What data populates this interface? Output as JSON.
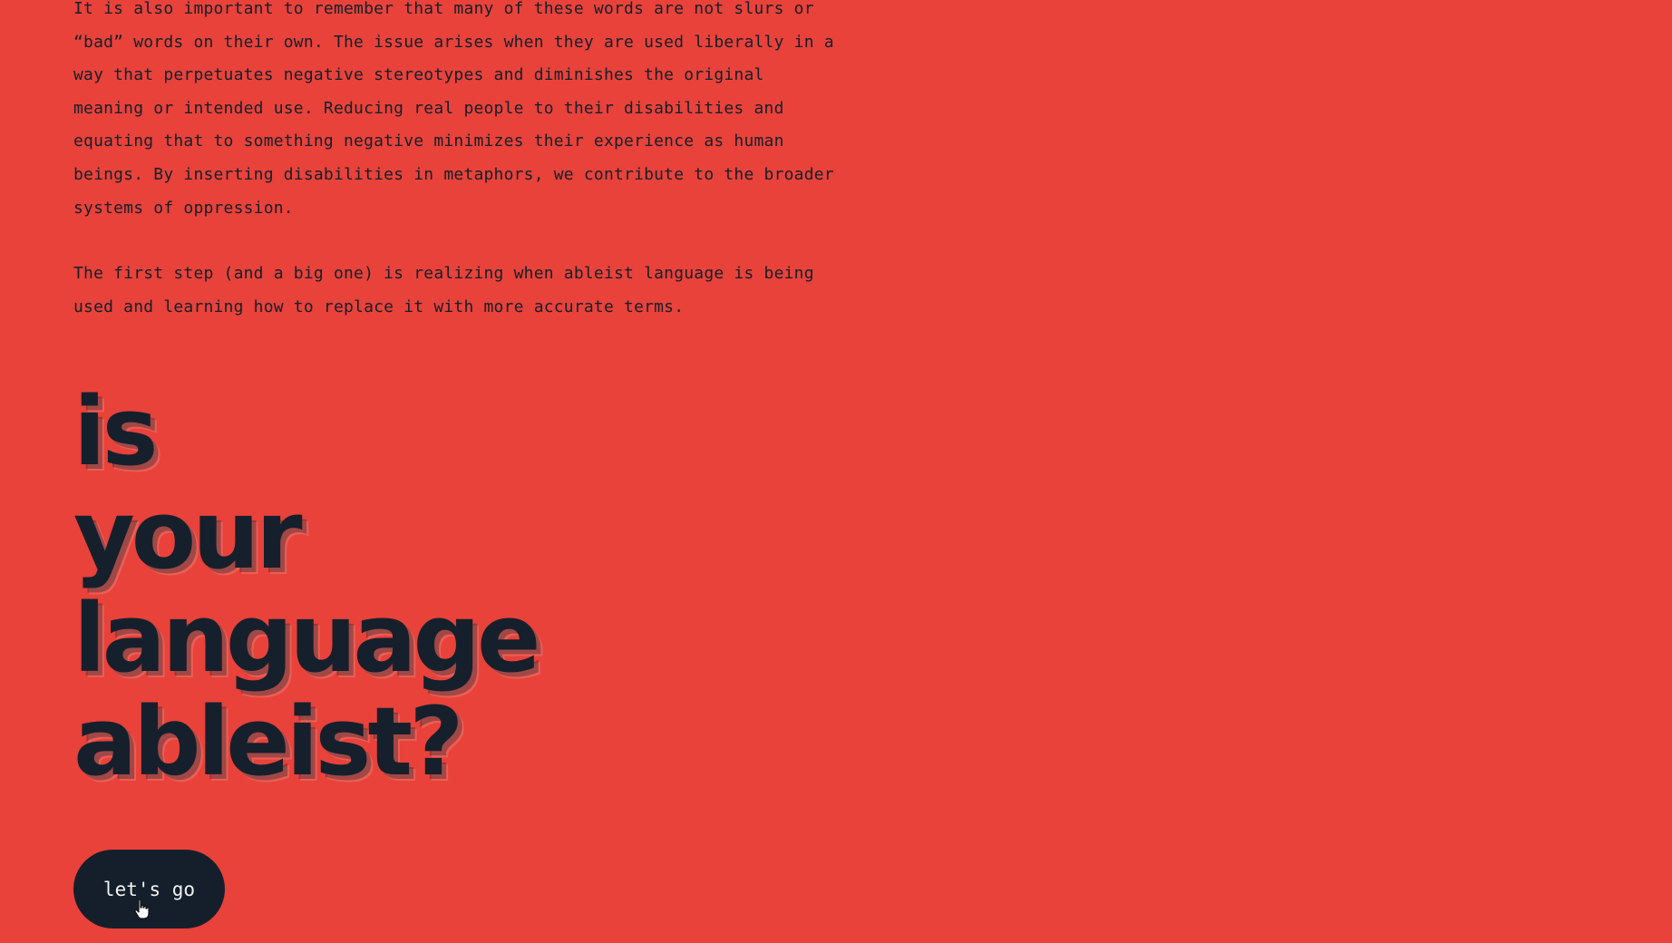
{
  "page": {
    "background_color": "#e8423a",
    "text_color": "#16202c"
  },
  "paragraphs": [
    "It is also important to remember that many of these words are not slurs or\n“bad” words on their own. The issue arises when they are used liberally in a\nway that perpetuates negative stereotypes and diminishes the original\nmeaning or intended use. Reducing real people to their disabilities and\nequating that to something negative minimizes their experience as human\nbeings. By inserting disabilities in metaphors, we contribute to the broader\nsystems of oppression.",
    "The first step (and a big one) is realizing when ableist language is being\nused and learning how to replace it with more accurate terms."
  ],
  "headline": {
    "lines": [
      "is",
      "your",
      "language",
      "ableist?"
    ]
  },
  "cta": {
    "label": "let's go",
    "background_color": "#151f2b",
    "text_color": "#f2f2f2"
  },
  "cursor": {
    "icon": "hand-pointer-icon"
  }
}
